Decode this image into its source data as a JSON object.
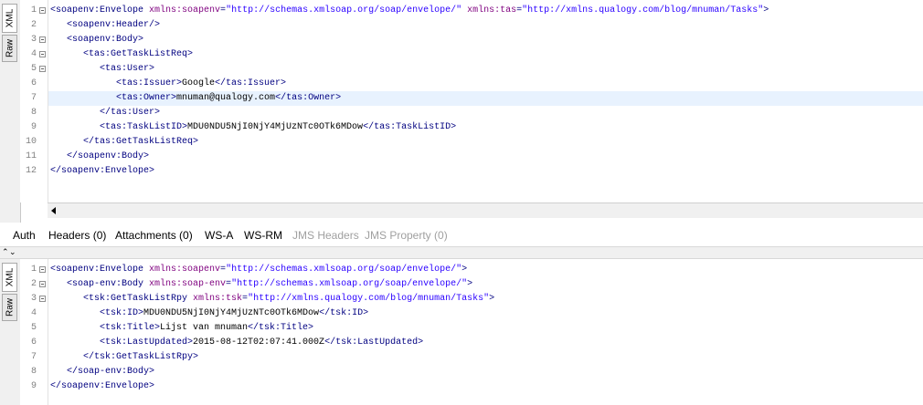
{
  "request": {
    "tabs": {
      "xml": "XML",
      "raw": "Raw"
    },
    "line_numbers": [
      "1",
      "2",
      "3",
      "4",
      "5",
      "6",
      "7",
      "8",
      "9",
      "10",
      "11",
      "12"
    ],
    "lines": [
      [
        {
          "c": "t",
          "s": "<soapenv:Envelope "
        },
        {
          "c": "a",
          "s": "xmlns:soapenv"
        },
        {
          "c": "t",
          "s": "="
        },
        {
          "c": "v",
          "s": "\"http://schemas.xmlsoap.org/soap/envelope/\""
        },
        {
          "c": "t",
          "s": " "
        },
        {
          "c": "a",
          "s": "xmlns:tas"
        },
        {
          "c": "t",
          "s": "="
        },
        {
          "c": "v",
          "s": "\"http://xmlns.qualogy.com/blog/mnuman/Tasks\""
        },
        {
          "c": "t",
          "s": ">"
        }
      ],
      [
        {
          "c": "t",
          "s": "   <soapenv:Header/>"
        }
      ],
      [
        {
          "c": "t",
          "s": "   <soapenv:Body>"
        }
      ],
      [
        {
          "c": "t",
          "s": "      <tas:GetTaskListReq>"
        }
      ],
      [
        {
          "c": "t",
          "s": "         <tas:User>"
        }
      ],
      [
        {
          "c": "t",
          "s": "            <tas:Issuer>"
        },
        {
          "c": "tx",
          "s": "Google"
        },
        {
          "c": "t",
          "s": "</tas:Issuer>"
        }
      ],
      [
        {
          "c": "t",
          "s": "            <tas:Owner>"
        },
        {
          "c": "tx",
          "s": "mnuman@qualogy.com"
        },
        {
          "c": "t",
          "s": "</tas:Owner>"
        }
      ],
      [
        {
          "c": "t",
          "s": "         </tas:User>"
        }
      ],
      [
        {
          "c": "t",
          "s": "         <tas:TaskListID>"
        },
        {
          "c": "tx",
          "s": "MDU0NDU5NjI0NjY4MjUzNTc0OTk6MDow"
        },
        {
          "c": "t",
          "s": "</tas:TaskListID>"
        }
      ],
      [
        {
          "c": "t",
          "s": "      </tas:GetTaskListReq>"
        }
      ],
      [
        {
          "c": "t",
          "s": "   </soapenv:Body>"
        }
      ],
      [
        {
          "c": "t",
          "s": "</soapenv:Envelope>"
        }
      ]
    ]
  },
  "bottom_tabs": [
    {
      "label": "Auth",
      "enabled": true
    },
    {
      "label": "Headers (0)",
      "enabled": true
    },
    {
      "label": "Attachments (0)",
      "enabled": true
    },
    {
      "label": "WS-A",
      "enabled": true
    },
    {
      "label": "WS-RM",
      "enabled": true
    },
    {
      "label": "JMS Headers",
      "enabled": false
    },
    {
      "label": "JMS Property (0)",
      "enabled": false
    }
  ],
  "response": {
    "tabs": {
      "xml": "XML",
      "raw": "Raw"
    },
    "line_numbers": [
      "1",
      "2",
      "3",
      "4",
      "5",
      "6",
      "7",
      "8",
      "9"
    ],
    "lines": [
      [
        {
          "c": "t",
          "s": "<soapenv:Envelope "
        },
        {
          "c": "a",
          "s": "xmlns:soapenv"
        },
        {
          "c": "t",
          "s": "="
        },
        {
          "c": "v",
          "s": "\"http://schemas.xmlsoap.org/soap/envelope/\""
        },
        {
          "c": "t",
          "s": ">"
        }
      ],
      [
        {
          "c": "t",
          "s": "   <soap-env:Body "
        },
        {
          "c": "a",
          "s": "xmlns:soap-env"
        },
        {
          "c": "t",
          "s": "="
        },
        {
          "c": "v",
          "s": "\"http://schemas.xmlsoap.org/soap/envelope/\""
        },
        {
          "c": "t",
          "s": ">"
        }
      ],
      [
        {
          "c": "t",
          "s": "      <tsk:GetTaskListRpy "
        },
        {
          "c": "a",
          "s": "xmlns:tsk"
        },
        {
          "c": "t",
          "s": "="
        },
        {
          "c": "v",
          "s": "\"http://xmlns.qualogy.com/blog/mnuman/Tasks\""
        },
        {
          "c": "t",
          "s": ">"
        }
      ],
      [
        {
          "c": "t",
          "s": "         <tsk:ID>"
        },
        {
          "c": "tx",
          "s": "MDU0NDU5NjI0NjY4MjUzNTc0OTk6MDow"
        },
        {
          "c": "t",
          "s": "</tsk:ID>"
        }
      ],
      [
        {
          "c": "t",
          "s": "         <tsk:Title>"
        },
        {
          "c": "tx",
          "s": "Lijst van mnuman"
        },
        {
          "c": "t",
          "s": "</tsk:Title>"
        }
      ],
      [
        {
          "c": "t",
          "s": "         <tsk:LastUpdated>"
        },
        {
          "c": "tx",
          "s": "2015-08-12T02:07:41.000Z"
        },
        {
          "c": "t",
          "s": "</tsk:LastUpdated>"
        }
      ],
      [
        {
          "c": "t",
          "s": "      </tsk:GetTaskListRpy>"
        }
      ],
      [
        {
          "c": "t",
          "s": "   </soap-env:Body>"
        }
      ],
      [
        {
          "c": "t",
          "s": "</soapenv:Envelope>"
        }
      ]
    ]
  }
}
